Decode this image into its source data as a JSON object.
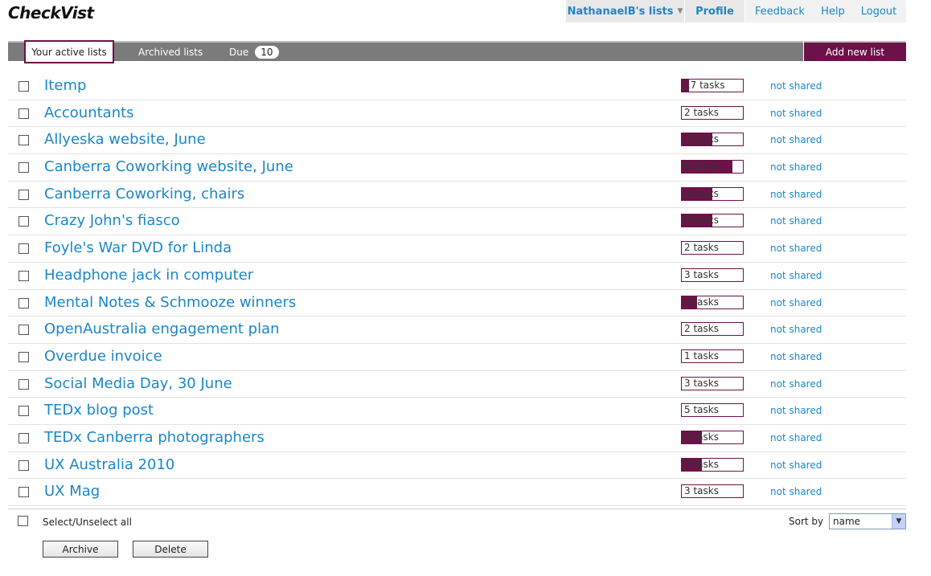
{
  "app": {
    "logo_text": "CheckVist"
  },
  "topnav": {
    "user_lists": "NathanaelB's lists",
    "profile": "Profile",
    "feedback": "Feedback",
    "help": "Help",
    "logout": "Logout"
  },
  "tabs": {
    "active": "Your active lists",
    "archived": "Archived lists",
    "due_label": "Due",
    "due_count": "10",
    "add_new": "Add new list"
  },
  "colors": {
    "accent": "#6b1348",
    "link": "#1a87c9",
    "tabbar": "#7b7b7b"
  },
  "lists": [
    {
      "title": "Itemp",
      "tasks": "17 tasks",
      "progress": 0.12,
      "share": "not shared"
    },
    {
      "title": "Accountants",
      "tasks": "2 tasks",
      "progress": 0,
      "share": "not shared"
    },
    {
      "title": "Allyeska website, June",
      "tasks": "2 tasks",
      "progress": 0.5,
      "share": "not shared"
    },
    {
      "title": "Canberra Coworking website, June",
      "tasks": "6 tasks",
      "progress": 0.83,
      "share": "not shared"
    },
    {
      "title": "Canberra Coworking, chairs",
      "tasks": "4 tasks",
      "progress": 0.5,
      "share": "not shared"
    },
    {
      "title": "Crazy John's fiasco",
      "tasks": "2 tasks",
      "progress": 0.5,
      "share": "not shared"
    },
    {
      "title": "Foyle's War DVD for Linda",
      "tasks": "2 tasks",
      "progress": 0,
      "share": "not shared"
    },
    {
      "title": "Headphone jack in computer",
      "tasks": "3 tasks",
      "progress": 0,
      "share": "not shared"
    },
    {
      "title": "Mental Notes & Schmooze winners",
      "tasks": "4 tasks",
      "progress": 0.25,
      "share": "not shared"
    },
    {
      "title": "OpenAustralia engagement plan",
      "tasks": "2 tasks",
      "progress": 0,
      "share": "not shared"
    },
    {
      "title": "Overdue invoice",
      "tasks": "1 tasks",
      "progress": 0,
      "share": "not shared"
    },
    {
      "title": "Social Media Day, 30 June",
      "tasks": "3 tasks",
      "progress": 0,
      "share": "not shared"
    },
    {
      "title": "TEDx blog post",
      "tasks": "5 tasks",
      "progress": 0,
      "share": "not shared"
    },
    {
      "title": "TEDx Canberra photographers",
      "tasks": "3 tasks",
      "progress": 0.33,
      "share": "not shared"
    },
    {
      "title": "UX Australia 2010",
      "tasks": "3 tasks",
      "progress": 0.33,
      "share": "not shared"
    },
    {
      "title": "UX Mag",
      "tasks": "3 tasks",
      "progress": 0,
      "share": "not shared"
    }
  ],
  "footer": {
    "select_all": "Select/Unselect all",
    "sort_label": "Sort by",
    "sort_value": "name",
    "archive_button": "Archive",
    "delete_button": "Delete"
  }
}
